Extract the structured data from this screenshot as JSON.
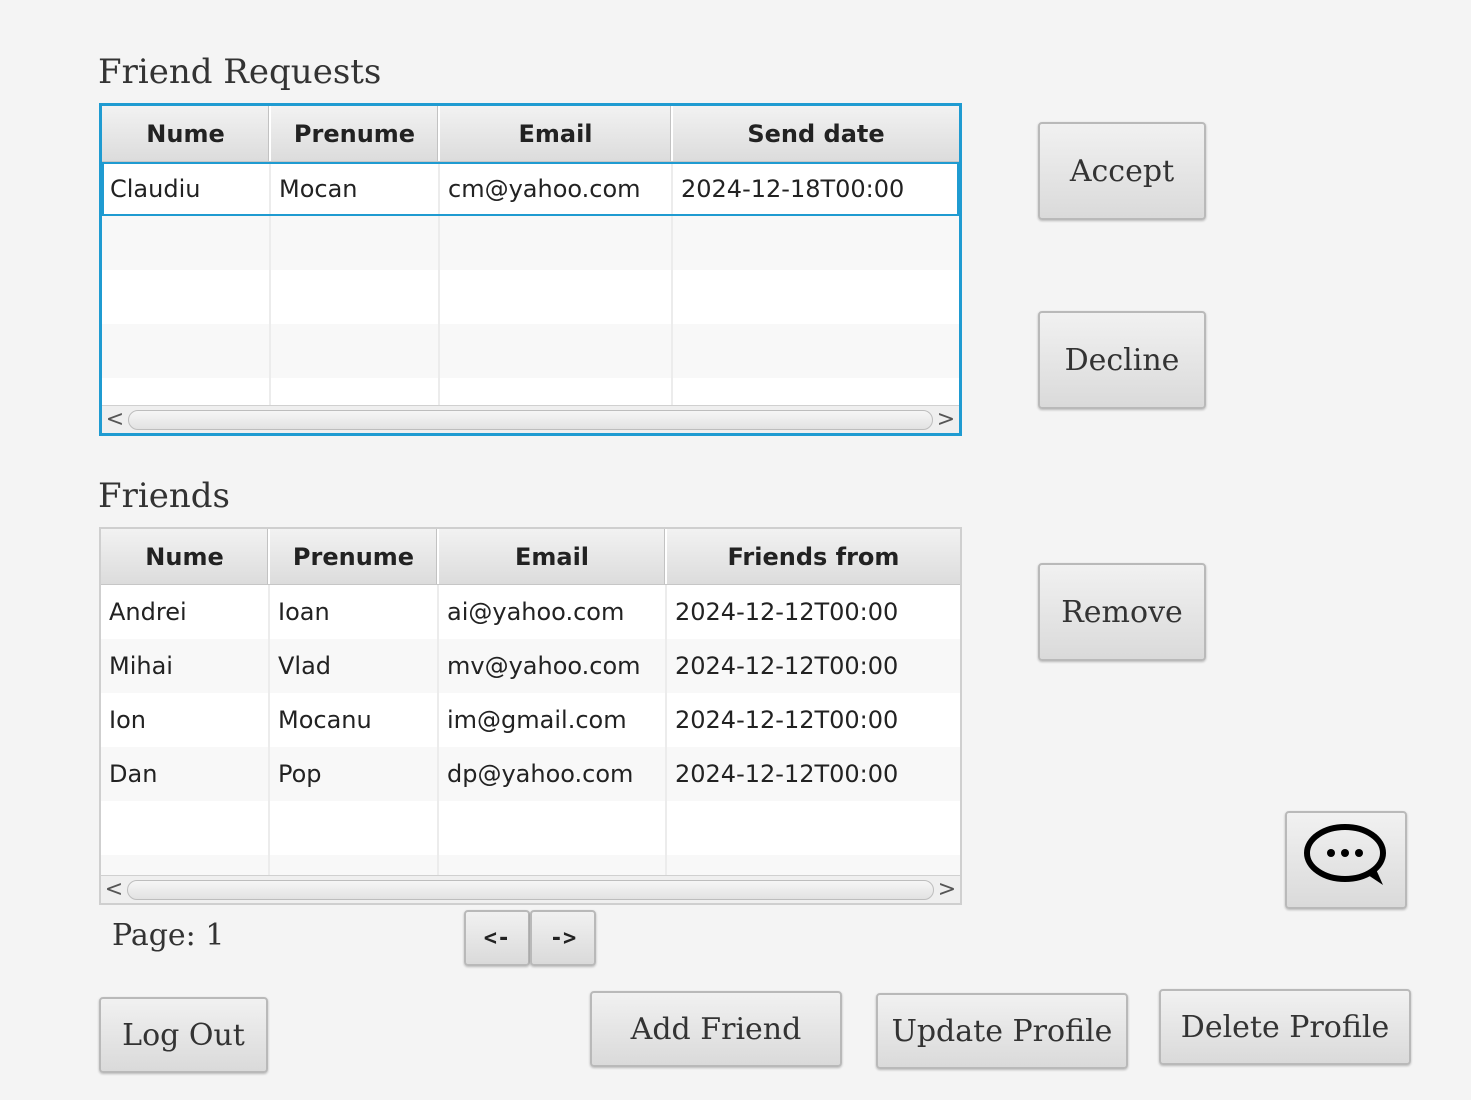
{
  "requests": {
    "title": "Friend Requests",
    "columns": [
      "Nume",
      "Prenume",
      "Email",
      "Send date"
    ],
    "rows": [
      [
        "Claudiu",
        "Mocan",
        "cm@yahoo.com",
        "2024-12-18T00:00"
      ]
    ],
    "scroll_left": "<",
    "scroll_right": ">"
  },
  "friends": {
    "title": "Friends",
    "columns": [
      "Nume",
      "Prenume",
      "Email",
      "Friends from"
    ],
    "rows": [
      [
        "Andrei",
        "Ioan",
        "ai@yahoo.com",
        "2024-12-12T00:00"
      ],
      [
        "Mihai",
        "Vlad",
        "mv@yahoo.com",
        "2024-12-12T00:00"
      ],
      [
        "Ion",
        "Mocanu",
        "im@gmail.com",
        "2024-12-12T00:00"
      ],
      [
        "Dan",
        "Pop",
        "dp@yahoo.com",
        "2024-12-12T00:00"
      ]
    ],
    "scroll_left": "<",
    "scroll_right": ">"
  },
  "buttons": {
    "accept": "Accept",
    "decline": "Decline",
    "remove": "Remove",
    "prev": "<-",
    "next": "->",
    "log_out": "Log Out",
    "add_friend": "Add Friend",
    "update_profile": "Update Profile",
    "delete_profile": "Delete Profile"
  },
  "pagination": {
    "label": "Page: 1"
  },
  "icons": {
    "chat": "chat-bubble-icon"
  },
  "colors": {
    "focus": "#1f9bd1",
    "background": "#f4f4f4"
  }
}
